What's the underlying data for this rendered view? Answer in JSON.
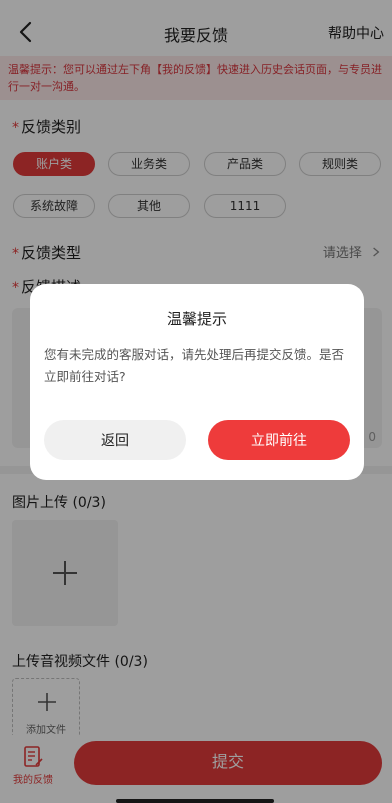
{
  "header": {
    "title": "我要反馈",
    "help_link": "帮助中心"
  },
  "notice": {
    "text": "温馨提示：您可以通过左下角【我的反馈】快速进入历史会话页面，与专员进行一对一沟通。"
  },
  "category": {
    "required_mark": "*",
    "label": "反馈类别",
    "options": [
      "账户类",
      "业务类",
      "产品类",
      "规则类",
      "系统故障",
      "其他",
      "1111"
    ],
    "selected": "账户类"
  },
  "feedback_type": {
    "required_mark": "*",
    "label": "反馈类型",
    "placeholder": "请选择"
  },
  "description": {
    "required_mark": "*",
    "label": "反馈描述",
    "counter": "0"
  },
  "image_upload": {
    "label": "图片上传 (0/3)"
  },
  "media_upload": {
    "label": "上传音视频文件 (0/3)",
    "add_label": "添加文件"
  },
  "bottom": {
    "my_feedback": "我的反馈",
    "submit": "提交"
  },
  "dialog": {
    "title": "温馨提示",
    "body": "您有未完成的客服对话，请先处理后再提交反馈。是否立即前往对话?",
    "back_label": "返回",
    "go_label": "立即前往"
  },
  "colors": {
    "accent": "#e23a3a",
    "notice_bg": "#fce9e9",
    "overlay": "rgba(0,0,0,0.38)"
  }
}
